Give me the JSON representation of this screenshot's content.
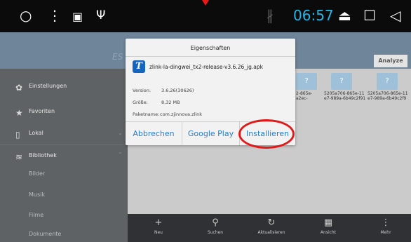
{
  "status_bar": {
    "time": "06:57",
    "icons": [
      "circle-home-icon",
      "more-vert-icon",
      "image-icon",
      "usb-icon",
      "bluetooth-icon",
      "eject-icon",
      "square-recents-icon",
      "back-triangle-icon"
    ],
    "glyphs": {
      "circle": "○",
      "dots": "⋮",
      "image": "▣",
      "usb": "Ψ",
      "bluetooth": "∦",
      "eject": "⏏",
      "square": "☐",
      "back": "◁"
    },
    "time_color": "#25b8e6"
  },
  "header": {
    "ghost_text": "ES",
    "analyze_tab": "Analyze"
  },
  "sidebar": {
    "items": [
      {
        "label": "Einstellungen",
        "icon": "gear-icon",
        "glyph": "✿"
      },
      {
        "label": "Favoriten",
        "icon": "star-icon",
        "glyph": "★"
      },
      {
        "label": "Lokal",
        "icon": "phone-icon",
        "glyph": "▯"
      },
      {
        "label": "Bibliothek",
        "icon": "stack-icon",
        "glyph": "≋"
      }
    ],
    "sub_items": [
      "Bilder",
      "Musik",
      "Filme",
      "Dokumente"
    ]
  },
  "files": [
    {
      "label_line1": "2-865e-",
      "label_line2": "a2ec-",
      "glyph": "?"
    },
    {
      "label_line1": "5205a706-865e-11",
      "label_line2": "e7-989a-6b49c2f91",
      "glyph": "?"
    },
    {
      "label_line1": "5205a706-865e-11",
      "label_line2": "e7-989a-6b49c2f9",
      "glyph": "?"
    }
  ],
  "toolbar": {
    "buttons": [
      {
        "label": "Neu",
        "glyph": "+",
        "icon": "plus-icon"
      },
      {
        "label": "Suchen",
        "glyph": "⚲",
        "icon": "search-icon"
      },
      {
        "label": "Aktualisieren",
        "glyph": "↻",
        "icon": "refresh-icon"
      },
      {
        "label": "Ansicht",
        "glyph": "▦",
        "icon": "grid-view-icon"
      },
      {
        "label": "Mehr",
        "glyph": "⋮",
        "icon": "more-vert-icon"
      }
    ]
  },
  "dialog": {
    "title": "Eigenschaften",
    "app_icon_letter": "T",
    "apk_name": "zlink-la-dingwei_tx2-release-v3.6.26_jg.apk",
    "version_label": "Version:",
    "version_value": "3.6.26(30626)",
    "size_label": "Größe:",
    "size_value": "8,32 MB",
    "package_label": "Paketname:",
    "package_value": "com.zjinnova.zlink",
    "cancel": "Abbrechen",
    "google_play": "Google Play",
    "install": "Installieren"
  }
}
